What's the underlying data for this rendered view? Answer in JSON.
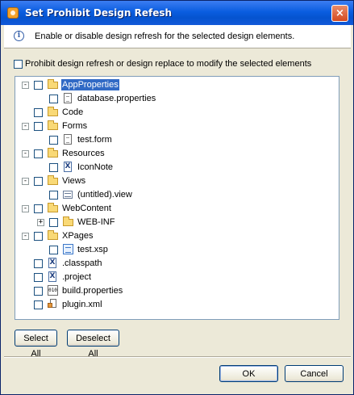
{
  "window": {
    "title": "Set Prohibit Design Refesh"
  },
  "info": {
    "text": "Enable or disable design refresh for the selected design elements."
  },
  "prohibit": {
    "label": "Prohibit design refresh or design replace to modify the selected elements"
  },
  "tree": {
    "rows": [
      {
        "label": "AppProperties",
        "icon": "folder-icon",
        "level": 0,
        "toggle": "−",
        "selected": true
      },
      {
        "label": "database.properties",
        "icon": "document-icon",
        "level": 1
      },
      {
        "label": "Code",
        "icon": "folder-icon",
        "level": 0
      },
      {
        "label": "Forms",
        "icon": "folder-icon",
        "level": 0,
        "toggle": "−"
      },
      {
        "label": "test.form",
        "icon": "document-icon",
        "level": 1
      },
      {
        "label": "Resources",
        "icon": "folder-icon",
        "level": 0,
        "toggle": "−"
      },
      {
        "label": "IconNote",
        "icon": "x-file-icon",
        "level": 1
      },
      {
        "label": "Views",
        "icon": "folder-icon",
        "level": 0,
        "toggle": "−"
      },
      {
        "label": "(untitled).view",
        "icon": "view-icon",
        "level": 1
      },
      {
        "label": "WebContent",
        "icon": "folder-icon",
        "level": 0,
        "toggle": "−"
      },
      {
        "label": "WEB-INF",
        "icon": "folder-icon",
        "level": 1,
        "toggle": "+"
      },
      {
        "label": "XPages",
        "icon": "folder-icon",
        "level": 0,
        "toggle": "−"
      },
      {
        "label": "test.xsp",
        "icon": "xsp-icon",
        "level": 1
      },
      {
        "label": ".classpath",
        "icon": "x-file-icon",
        "level": 0
      },
      {
        "label": ".project",
        "icon": "x-file-icon",
        "level": 0
      },
      {
        "label": "build.properties",
        "icon": "binary-file-icon",
        "level": 0
      },
      {
        "label": "plugin.xml",
        "icon": "plugin-icon",
        "level": 0
      }
    ]
  },
  "buttons": {
    "select_all": "Select All",
    "deselect_all": "Deselect All",
    "ok": "OK",
    "cancel": "Cancel"
  },
  "icons": {
    "close": "×",
    "info": "i",
    "binary": "010",
    "xfile": "X"
  },
  "colors": {
    "titlebar": "#0a5de0",
    "selection": "#316ac5",
    "dialog_bg": "#ece9d8",
    "folder": "#f9d976"
  }
}
